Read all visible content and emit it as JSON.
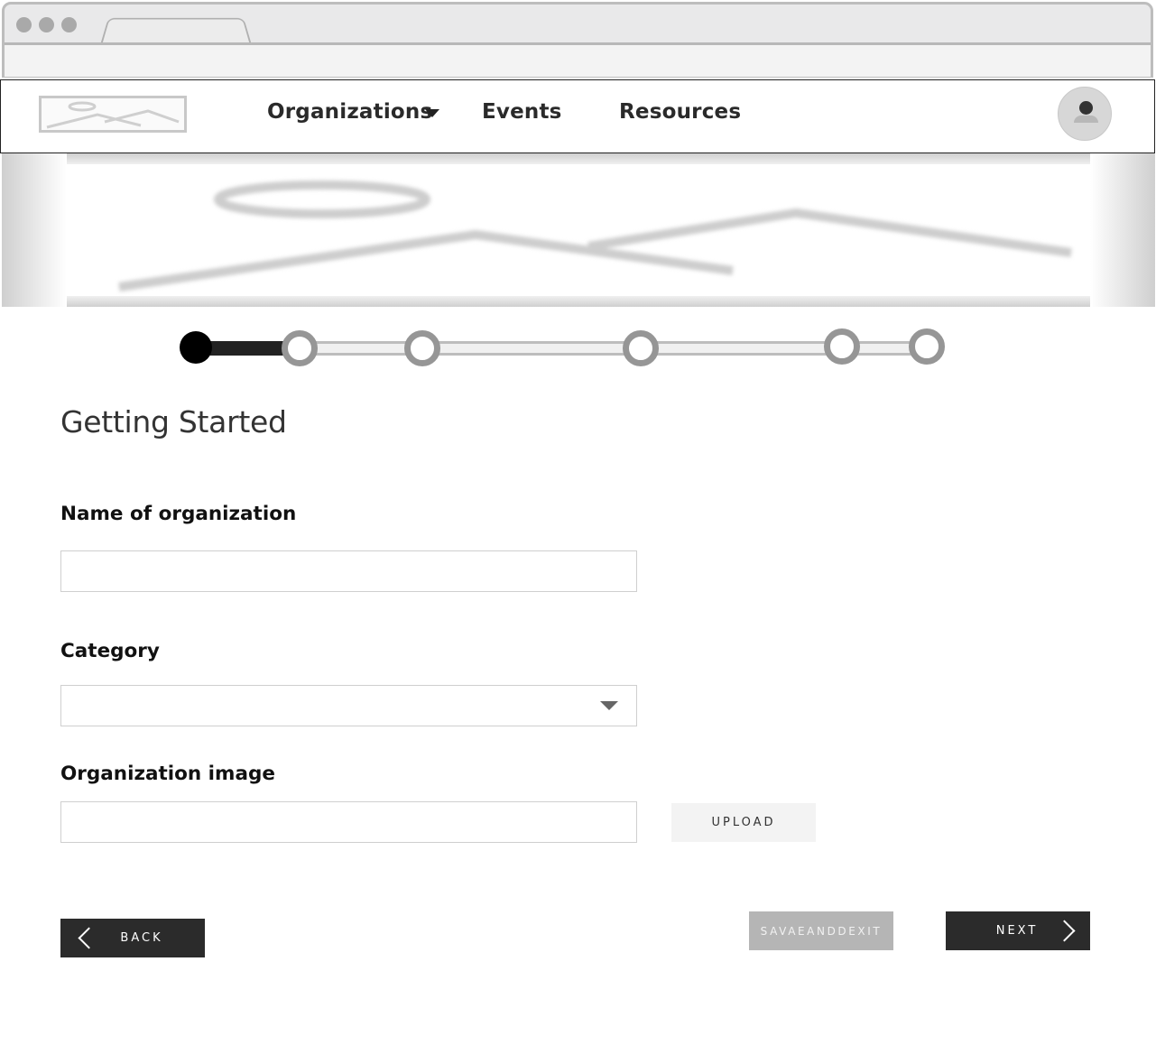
{
  "nav": {
    "items": [
      {
        "label": "Organizations",
        "has_dropdown": true
      },
      {
        "label": "Events",
        "has_dropdown": false
      },
      {
        "label": "Resources",
        "has_dropdown": false
      }
    ]
  },
  "stepper": {
    "total_steps": 6,
    "current_step": 1
  },
  "form": {
    "title": "Getting Started",
    "name_label": "Name of organization",
    "name_value": "",
    "category_label": "Category",
    "category_value": "",
    "image_label": "Organization image",
    "image_value": "",
    "upload_label": "UPLOAD"
  },
  "actions": {
    "back_label": "BACK",
    "save_label": "SAVAEANDDEXIT",
    "next_label": "NEXT"
  },
  "colors": {
    "dark": "#2b2b2b",
    "disabled": "#b5b5b5",
    "step_inactive": "#969696"
  }
}
